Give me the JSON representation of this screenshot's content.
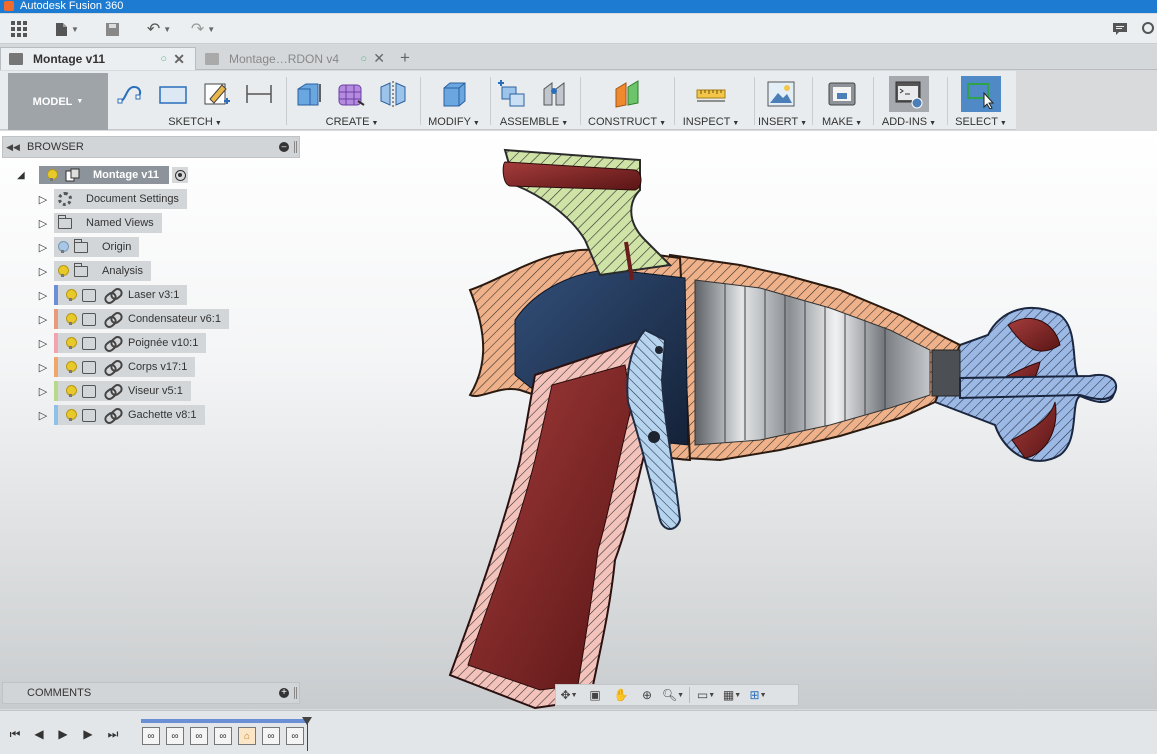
{
  "app": {
    "title": "Autodesk Fusion 360"
  },
  "tabs": [
    {
      "label": "Montage v11",
      "active": true
    },
    {
      "label": "Montage…RDON v4",
      "active": false
    }
  ],
  "ribbon": {
    "workspace": "MODEL",
    "groups": [
      "SKETCH",
      "CREATE",
      "MODIFY",
      "ASSEMBLE",
      "CONSTRUCT",
      "INSPECT",
      "INSERT",
      "MAKE",
      "ADD-INS",
      "SELECT"
    ]
  },
  "browser": {
    "title": "BROWSER",
    "root": "Montage v11",
    "items": [
      {
        "label": "Document Settings",
        "icon": "gear-icon"
      },
      {
        "label": "Named Views",
        "icon": "folder-icon"
      },
      {
        "label": "Origin",
        "icon": "folder-icon",
        "bulb": "off"
      },
      {
        "label": "Analysis",
        "icon": "folder-icon",
        "bulb": "on"
      },
      {
        "label": "Laser v3:1",
        "icon": "component-icon",
        "color": "#6b8fd6"
      },
      {
        "label": "Condensateur v6:1",
        "icon": "component-icon",
        "color": "#e89a7a"
      },
      {
        "label": "Poignée v10:1",
        "icon": "component-icon",
        "color": "#f3a3b0"
      },
      {
        "label": "Corps v17:1",
        "icon": "component-icon",
        "color": "#f0a56a"
      },
      {
        "label": "Viseur v5:1",
        "icon": "component-icon",
        "color": "#b8d88a"
      },
      {
        "label": "Gachette v8:1",
        "icon": "component-icon",
        "color": "#8fc0ea"
      }
    ]
  },
  "comments": {
    "title": "COMMENTS"
  },
  "colors": {
    "titlebar": "#1e7bd2",
    "select_active": "#4f89c6",
    "timeline_track": "#6a8fd6"
  }
}
